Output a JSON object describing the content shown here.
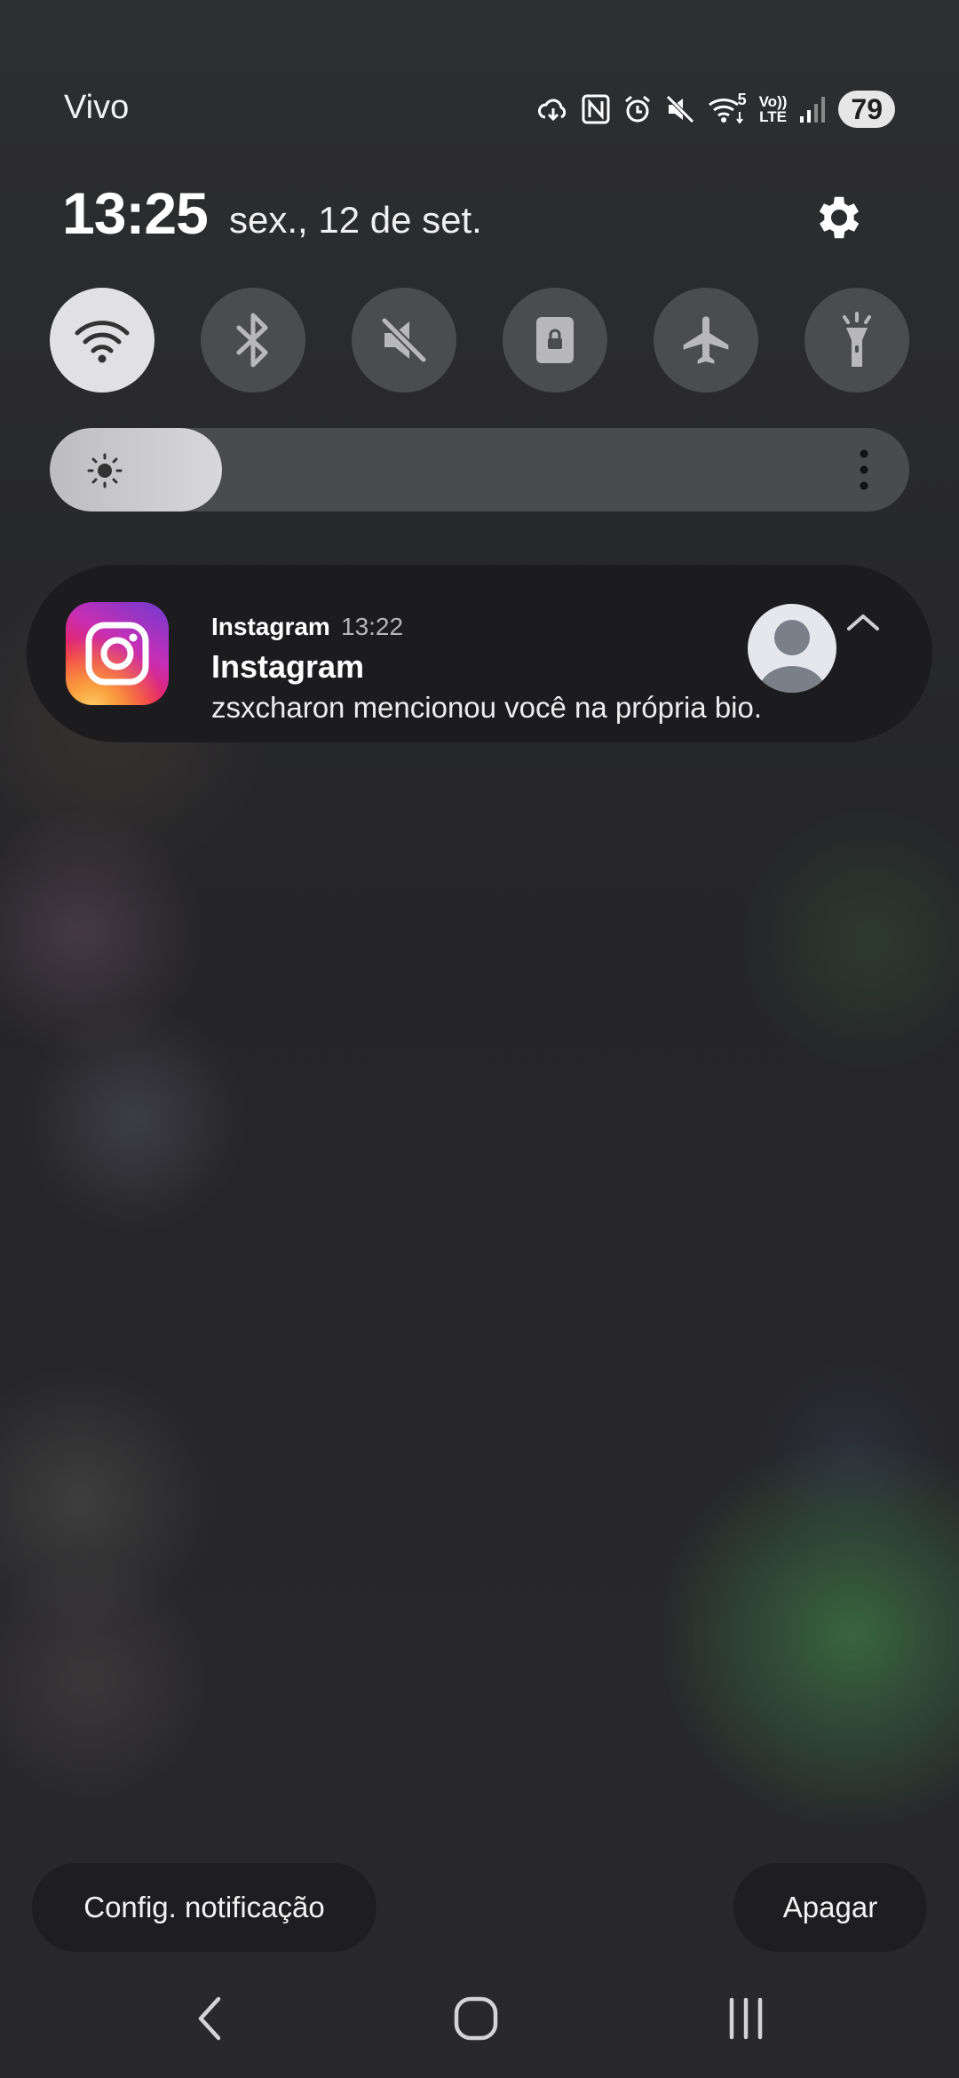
{
  "status_bar": {
    "carrier": "Vivo",
    "battery": "79",
    "icons": [
      "cloud-sync-icon",
      "nfc-icon",
      "alarm-icon",
      "mute-icon",
      "wifi-5-icon",
      "volte-icon",
      "signal-icon",
      "battery-icon"
    ],
    "volte_top": "Vo))",
    "volte_bottom": "LTE",
    "wifi_badge": "5"
  },
  "header": {
    "time": "13:25",
    "date": "sex., 12 de set."
  },
  "quick_settings": [
    {
      "name": "wifi",
      "icon": "wifi-icon",
      "active": true
    },
    {
      "name": "bluetooth",
      "icon": "bluetooth-icon",
      "active": false
    },
    {
      "name": "sound",
      "icon": "mute-icon",
      "active": false
    },
    {
      "name": "rotation-lock",
      "icon": "lock-icon",
      "active": false
    },
    {
      "name": "airplane-mode",
      "icon": "airplane-icon",
      "active": false
    },
    {
      "name": "flashlight",
      "icon": "flashlight-icon",
      "active": false
    }
  ],
  "brightness": {
    "level": 0.2
  },
  "notification": {
    "app_name": "Instagram",
    "time": "13:22",
    "title": "Instagram",
    "body": "zsxcharon mencionou você na própria bio."
  },
  "actions": {
    "config_label": "Config. notificação",
    "clear_label": "Apagar"
  },
  "colors": {
    "panel_bg": "#2a2a2d",
    "toggle_on": "#e1e1e3",
    "toggle_off": "#4b4c50",
    "card_bg": "#1c1c1e"
  }
}
